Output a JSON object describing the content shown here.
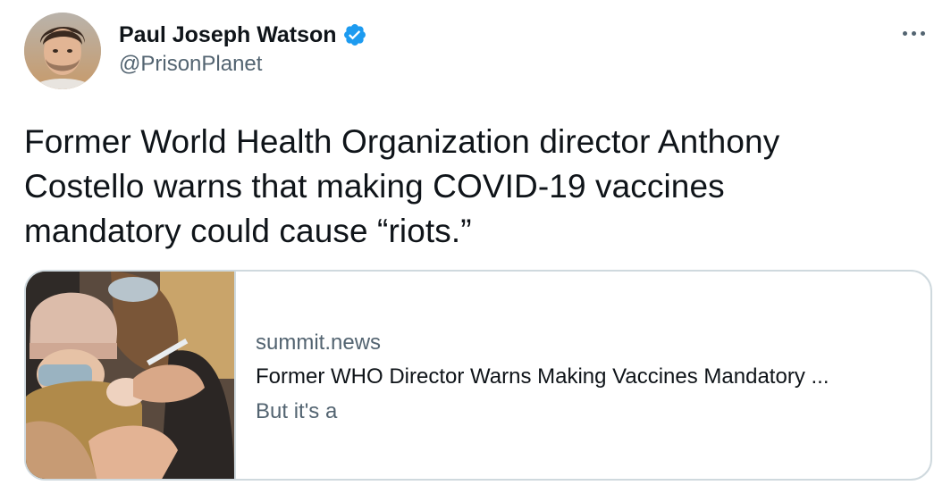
{
  "author": {
    "display_name": "Paul Joseph Watson",
    "handle": "@PrisonPlanet",
    "verified": true
  },
  "tweet": {
    "text_lines": [
      "Former World Health Organization director Anthony",
      "Costello warns that making COVID-19 vaccines",
      "mandatory could cause “riots.”"
    ]
  },
  "link_card": {
    "domain": "summit.news",
    "title": "Former WHO Director Warns Making Vaccines Mandatory ...",
    "description": "But it's a"
  },
  "colors": {
    "text_primary": "#0f1419",
    "text_secondary": "#536471",
    "verified_blue": "#1d9bf0",
    "card_border": "#cfd9de"
  },
  "icons": {
    "verified": "verified-badge-icon",
    "more": "more-horizontal-icon"
  }
}
